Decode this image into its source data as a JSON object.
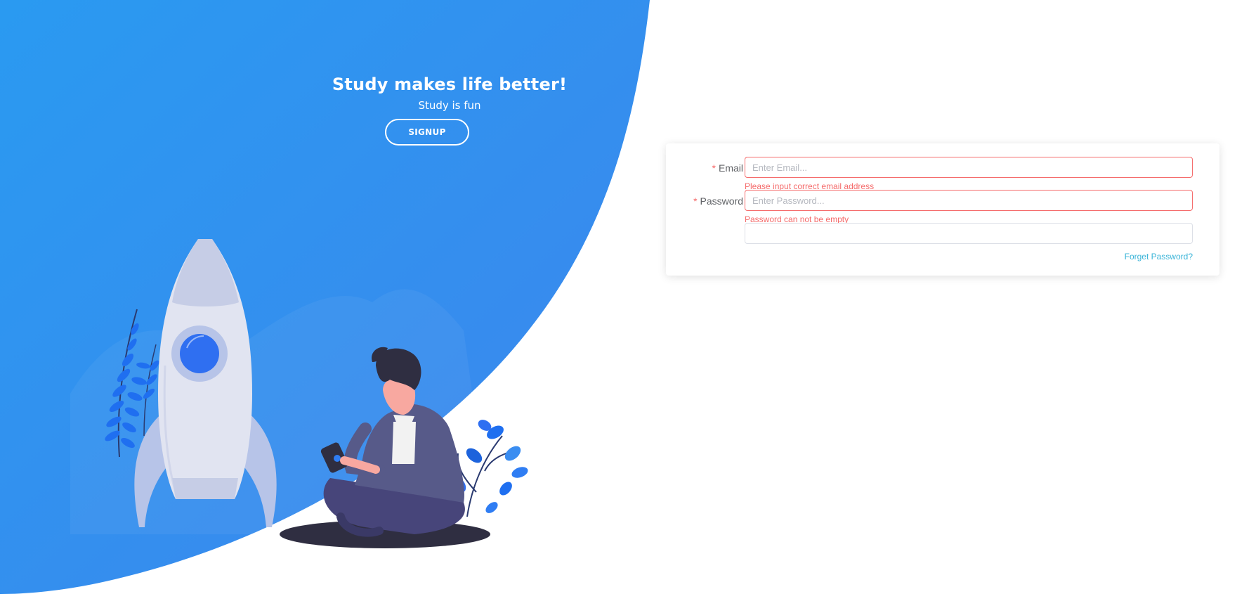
{
  "hero": {
    "title": "Study makes life better!",
    "subtitle": "Study is fun",
    "signup_label": "SIGNUP"
  },
  "form": {
    "email": {
      "label": "Email",
      "required_mark": "*",
      "placeholder": "Enter Email...",
      "value": "",
      "error": "Please input correct email address"
    },
    "password": {
      "label": "Password",
      "required_mark": "*",
      "placeholder": "Enter Password...",
      "value": "",
      "error": "Password can not be empty"
    },
    "extra_field": {
      "value": ""
    },
    "forget_password": "Forget Password?"
  },
  "colors": {
    "accent_blue": "#3a8ee6",
    "error_red": "#f56c6c",
    "link_cyan": "#3ab4d8",
    "figure_purple": "#575a89",
    "rocket_body": "#e1e4f1"
  },
  "illustration": {
    "icons": [
      "rocket-icon",
      "person-icon",
      "plant-icon",
      "phone-icon"
    ]
  }
}
